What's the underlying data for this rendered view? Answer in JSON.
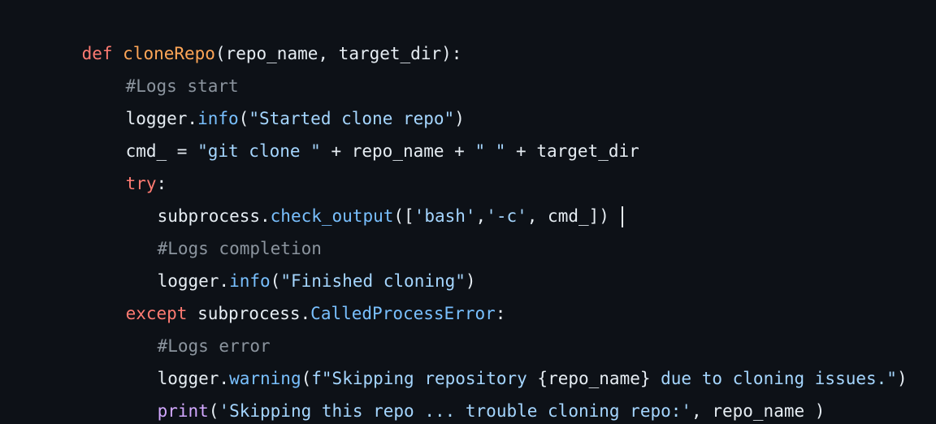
{
  "code": {
    "lines": [
      [
        {
          "t": "def ",
          "c": "kw"
        },
        {
          "t": "cloneRepo",
          "c": "fn"
        },
        {
          "t": "(repo_name, target_dir):",
          "c": "pl"
        }
      ],
      [
        {
          "t": "#Logs start",
          "c": "cm"
        }
      ],
      [
        {
          "t": "logger.",
          "c": "pl"
        },
        {
          "t": "info",
          "c": "at"
        },
        {
          "t": "(",
          "c": "pl"
        },
        {
          "t": "\"Started clone repo\"",
          "c": "st"
        },
        {
          "t": ")",
          "c": "pl"
        }
      ],
      [
        {
          "t": "cmd_ = ",
          "c": "pl"
        },
        {
          "t": "\"git clone \"",
          "c": "st"
        },
        {
          "t": " + repo_name + ",
          "c": "pl"
        },
        {
          "t": "\" \"",
          "c": "st"
        },
        {
          "t": " + target_dir",
          "c": "pl"
        }
      ],
      [
        {
          "t": "try",
          "c": "kw"
        },
        {
          "t": ":",
          "c": "pl"
        }
      ],
      [
        {
          "t": "subprocess.",
          "c": "pl"
        },
        {
          "t": "check_output",
          "c": "at"
        },
        {
          "t": "([",
          "c": "pl"
        },
        {
          "t": "'bash'",
          "c": "st"
        },
        {
          "t": ",",
          "c": "pl"
        },
        {
          "t": "'-c'",
          "c": "st"
        },
        {
          "t": ", cmd_]) ",
          "c": "pl"
        }
      ],
      [
        {
          "t": "#Logs completion",
          "c": "cm"
        }
      ],
      [
        {
          "t": "logger.",
          "c": "pl"
        },
        {
          "t": "info",
          "c": "at"
        },
        {
          "t": "(",
          "c": "pl"
        },
        {
          "t": "\"Finished cloning\"",
          "c": "st"
        },
        {
          "t": ")",
          "c": "pl"
        }
      ],
      [
        {
          "t": "except ",
          "c": "kw"
        },
        {
          "t": "subprocess.",
          "c": "pl"
        },
        {
          "t": "CalledProcessError",
          "c": "cl"
        },
        {
          "t": ":",
          "c": "pl"
        }
      ],
      [
        {
          "t": "#Logs error",
          "c": "cm"
        }
      ],
      [
        {
          "t": "logger.",
          "c": "pl"
        },
        {
          "t": "warning",
          "c": "at"
        },
        {
          "t": "(",
          "c": "pl"
        },
        {
          "t": "f\"Skipping repository ",
          "c": "st"
        },
        {
          "t": "{repo_name}",
          "c": "pl"
        },
        {
          "t": " due to cloning issues.\"",
          "c": "st"
        },
        {
          "t": ")",
          "c": "pl"
        }
      ],
      [
        {
          "t": "print",
          "c": "bi"
        },
        {
          "t": "(",
          "c": "pl"
        },
        {
          "t": "'Skipping this repo ... trouble cloning repo:'",
          "c": "st"
        },
        {
          "t": ", repo_name )",
          "c": "pl"
        }
      ]
    ]
  },
  "colors": {
    "background": "#0d1117",
    "keyword": "#ff7b72",
    "function": "#ffa657",
    "plain": "#e6edf3",
    "comment": "#8b949e",
    "attribute": "#79c0ff",
    "string": "#a5d6ff",
    "builtin": "#d2a8ff"
  }
}
